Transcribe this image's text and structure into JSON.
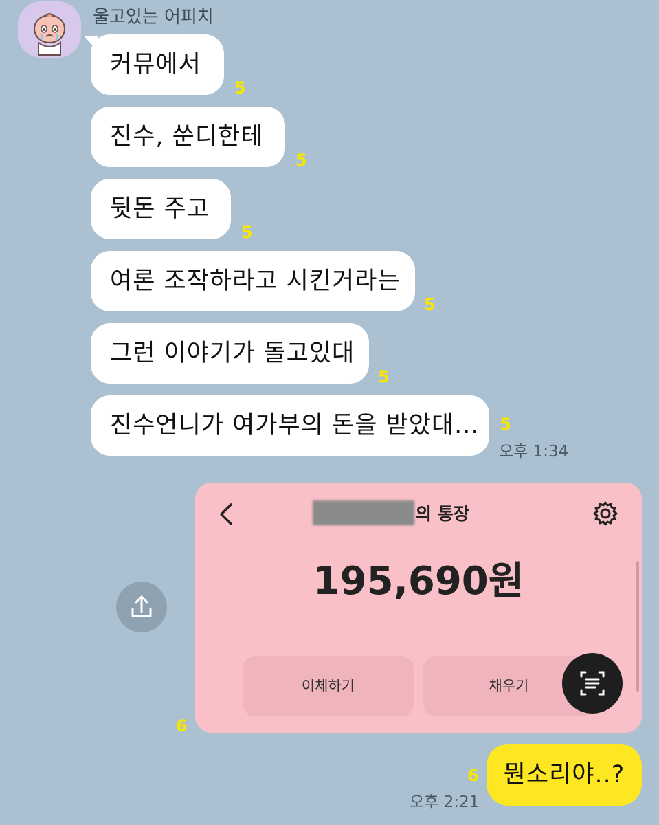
{
  "chat": {
    "sender_name": "울고있는 어피치",
    "messages": [
      {
        "text": "커뮤에서",
        "unread": "5"
      },
      {
        "text": "진수, 쑨디한테",
        "unread": "5"
      },
      {
        "text": "뒷돈 주고",
        "unread": "5"
      },
      {
        "text": "여론 조작하라고 시킨거라는",
        "unread": "5"
      },
      {
        "text": "그런 이야기가 돌고있대",
        "unread": "5"
      },
      {
        "text": "진수언니가 여가부의 돈을 받았대...",
        "unread": "5"
      }
    ],
    "received_time": "오후 1:34"
  },
  "shared_image": {
    "unread": "6",
    "account_title_suffix": "의 통장",
    "balance": "195,690원",
    "transfer_label": "이체하기",
    "charge_label": "채우기"
  },
  "my_message": {
    "text": "뭔소리야..?",
    "unread": "6",
    "time": "오후 2:21"
  },
  "colors": {
    "background": "#abc1d1",
    "my_bubble": "#fde723",
    "unread": "#f7e600",
    "card": "#fac0c8"
  }
}
